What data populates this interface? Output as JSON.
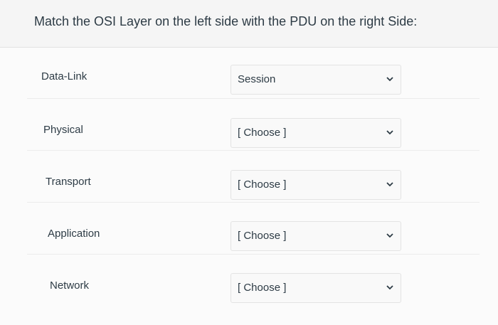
{
  "question": {
    "text": "Match the OSI Layer on the left side with the PDU on the right Side:"
  },
  "matches": [
    {
      "layer": "Data-Link",
      "selected": "Session"
    },
    {
      "layer": "Physical",
      "selected": "[ Choose ]"
    },
    {
      "layer": "Transport",
      "selected": "[ Choose ]"
    },
    {
      "layer": "Application",
      "selected": "[ Choose ]"
    },
    {
      "layer": "Network",
      "selected": "[ Choose ]"
    }
  ],
  "icons": {
    "dropdown": "chevron-down-icon"
  },
  "colors": {
    "text": "#2d3b45",
    "chevron": "#2d3b45",
    "border": "#e3e3e3"
  }
}
